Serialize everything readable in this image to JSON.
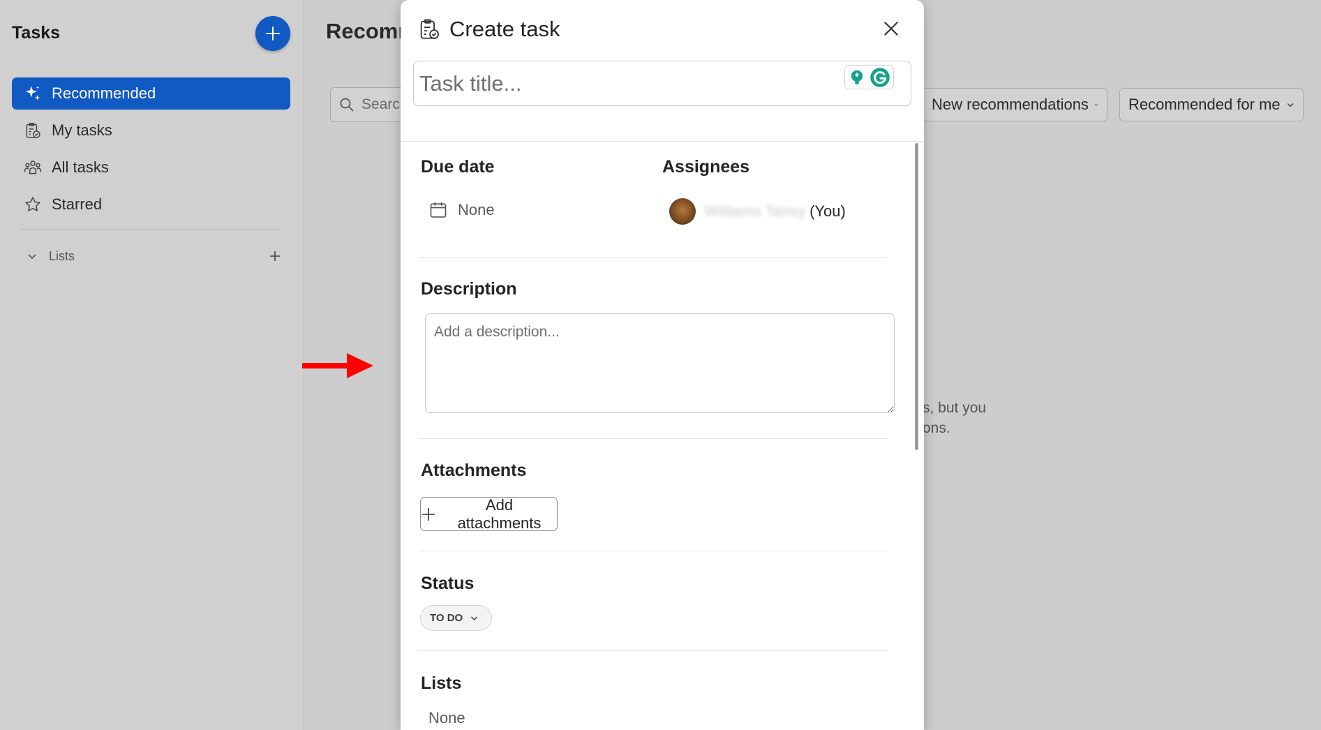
{
  "sidebar": {
    "title": "Tasks",
    "items": [
      {
        "label": "Recommended",
        "icon": "sparkle-icon",
        "active": true
      },
      {
        "label": "My tasks",
        "icon": "clipboard-check-icon",
        "active": false
      },
      {
        "label": "All tasks",
        "icon": "people-icon",
        "active": false
      },
      {
        "label": "Starred",
        "icon": "star-icon",
        "active": false
      }
    ],
    "lists_label": "Lists"
  },
  "main": {
    "title": "Recomm",
    "search_placeholder": "Searc",
    "filters": [
      {
        "label": "New recommendations"
      },
      {
        "label": "Recommended for me"
      }
    ],
    "empty_line1": "s, but you",
    "empty_line2": "ons."
  },
  "modal": {
    "title": "Create task",
    "title_placeholder": "Task title...",
    "due_date": {
      "label": "Due date",
      "value": "None"
    },
    "assignees": {
      "label": "Assignees",
      "name": "Williams Tansy",
      "suffix": "(You)"
    },
    "description": {
      "label": "Description",
      "placeholder": "Add a description..."
    },
    "attachments": {
      "label": "Attachments",
      "button": "Add attachments"
    },
    "status": {
      "label": "Status",
      "value": "TO DO"
    },
    "lists": {
      "label": "Lists",
      "value": "None"
    }
  },
  "colors": {
    "accent": "#1159c3",
    "arrow": "#ff0000",
    "grammarly": "#15a18a"
  }
}
